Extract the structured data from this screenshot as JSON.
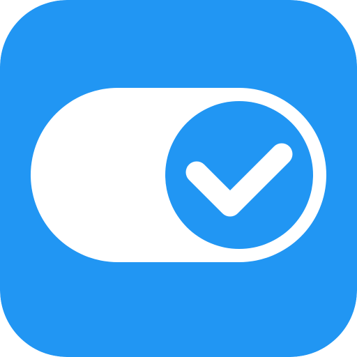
{
  "icon": {
    "name": "toggle-switch-on-checkmark",
    "state": "on",
    "colors": {
      "background": "#2196F3",
      "track": "#FFFFFF",
      "knob": "#2196F3",
      "checkmark": "#FFFFFF"
    }
  }
}
